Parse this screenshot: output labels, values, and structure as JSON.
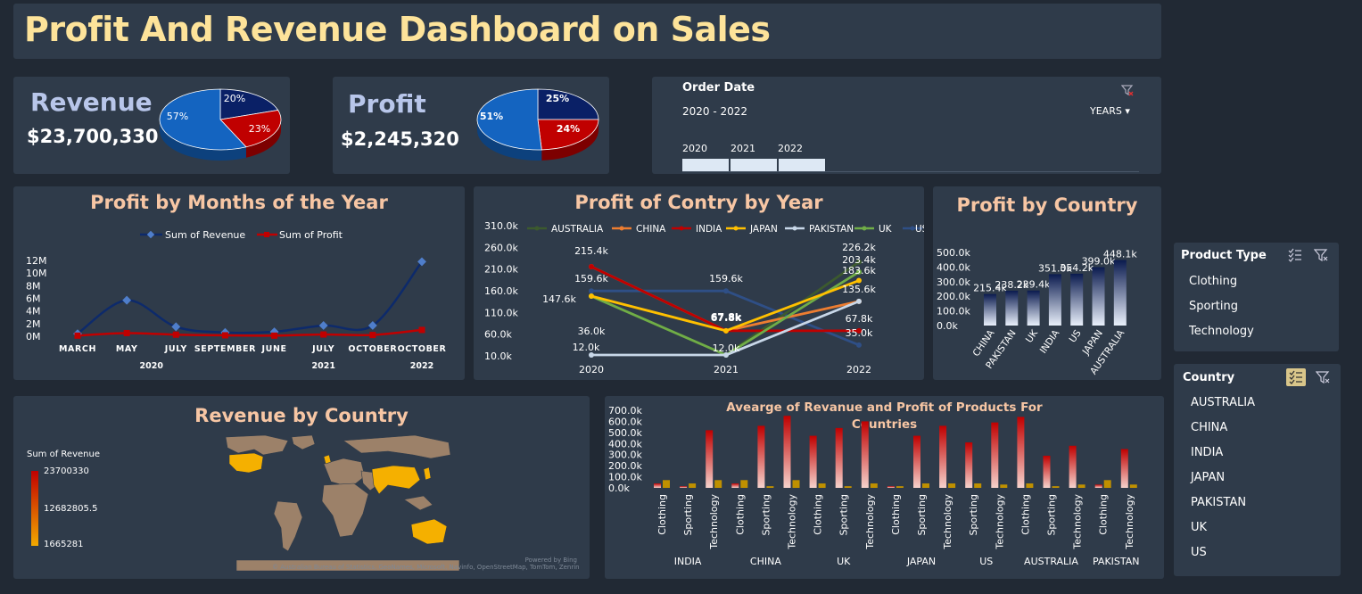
{
  "dashboard": {
    "title": "Profit And Revenue Dashboard on Sales"
  },
  "kpis": {
    "revenue": {
      "label": "Revenue",
      "value": "$23,700,330",
      "slices": [
        57,
        20,
        23
      ],
      "slice_labels": [
        "57%",
        "20%",
        "23%"
      ],
      "colors": [
        "#1464c0",
        "#0a2066",
        "#c00000"
      ]
    },
    "profit": {
      "label": "Profit",
      "value": "$2,245,320",
      "slices": [
        51,
        25,
        24
      ],
      "slice_labels": [
        "51%",
        "25%",
        "24%"
      ],
      "colors": [
        "#1464c0",
        "#0a2066",
        "#c00000"
      ]
    }
  },
  "timeline": {
    "title": "Order Date",
    "range": "2020 - 2022",
    "unit": "YEARS",
    "years": [
      "2020",
      "2021",
      "2022"
    ]
  },
  "months_chart": {
    "title": "Profit by Months of the Year",
    "legend": [
      "Sum of Revenue",
      "Sum of Profit"
    ],
    "colors": [
      "#0d2a6b",
      "#c00000"
    ],
    "y_ticks": [
      "12M",
      "10M",
      "8M",
      "6M",
      "4M",
      "2M",
      "0M"
    ],
    "months": [
      "MARCH",
      "MAY",
      "JULY",
      "SEPTEMBER",
      "JUNE",
      "JULY",
      "OCTOBER",
      "OCTOBER"
    ],
    "years": [
      "2020",
      "2021",
      "2022"
    ]
  },
  "country_year_chart": {
    "title": "Profit of Contry by Year",
    "legend": [
      "AUSTRALIA",
      "CHINA",
      "INDIA",
      "JAPAN",
      "PAKISTAN",
      "UK",
      "US"
    ],
    "colors": [
      "#3c5a2e",
      "#ed7d31",
      "#c00000",
      "#ffc000",
      "#c8d7e8",
      "#70ad47",
      "#2f4f86"
    ],
    "y_ticks": [
      "310.0k",
      "260.0k",
      "210.0k",
      "160.0k",
      "110.0k",
      "60.0k",
      "10.0k"
    ],
    "x_labels": [
      "2020",
      "2021",
      "2022"
    ],
    "data_labels": [
      "215.4k",
      "159.6k",
      "147.6k",
      "36.0k",
      "12.0k",
      "159.6k",
      "67.8k",
      "67.8k",
      "12.0k",
      "226.2k",
      "203.4k",
      "183.6k",
      "135.6k",
      "67.8k",
      "35.0k"
    ]
  },
  "profit_country_chart": {
    "title": "Profit by Country",
    "y_ticks": [
      "500.0k",
      "400.0k",
      "300.0k",
      "200.0k",
      "100.0k",
      "0.0k"
    ],
    "bar_top": "#0a1a4e",
    "bar_bottom": "#e9f0fb"
  },
  "revenue_map": {
    "title": "Revenue by Country",
    "legend_title": "Sum of Revenue",
    "legend_values": [
      "23700330",
      "12682805.5",
      "1665281"
    ],
    "attribution_1": "Powered by Bing",
    "attribution_2": "© Australian Bureau of Statistics, GeoNames, Microsoft, Navinfo, OpenStreetMap, TomTom, Zenrin"
  },
  "products_chart": {
    "title_1": "Avearge of Revanue and Profit of Products For",
    "title_2": "Countries",
    "y_ticks": [
      "700.0k",
      "600.0k",
      "500.0k",
      "400.0k",
      "300.0k",
      "200.0k",
      "100.0k",
      "0.0k"
    ],
    "countries": [
      "INDIA",
      "CHINA",
      "UK",
      "JAPAN",
      "US",
      "AUSTRALIA",
      "PAKISTAN"
    ],
    "products": [
      "Clothing",
      "Sporting",
      "Technology"
    ],
    "colors": [
      "#c00000",
      "#bf9000"
    ]
  },
  "product_slicer": {
    "title": "Product Type",
    "items": [
      "Clothing",
      "Sporting",
      "Technology"
    ]
  },
  "country_slicer": {
    "title": "Country",
    "items": [
      "AUSTRALIA",
      "CHINA",
      "INDIA",
      "JAPAN",
      "PAKISTAN",
      "UK",
      "US"
    ]
  },
  "chart_data": [
    {
      "type": "pie",
      "title": "Revenue",
      "categories": [
        "",
        "",
        ""
      ],
      "values": [
        57,
        20,
        23
      ]
    },
    {
      "type": "pie",
      "title": "Profit",
      "categories": [
        "",
        "",
        ""
      ],
      "values": [
        51,
        25,
        24
      ]
    },
    {
      "type": "line",
      "title": "Profit by Months of the Year",
      "categories": [
        "2020 MARCH",
        "2020 MAY",
        "2020 JULY",
        "2020 SEPTEMBER",
        "2021 JUNE",
        "2021 JULY",
        "2021 OCTOBER",
        "2022 OCTOBER"
      ],
      "series": [
        {
          "name": "Sum of Revenue",
          "values": [
            400000,
            5700000,
            1500000,
            600000,
            700000,
            1700000,
            1700000,
            11800000
          ]
        },
        {
          "name": "Sum of Profit",
          "values": [
            100000,
            500000,
            250000,
            150000,
            100000,
            280000,
            200000,
            1000000
          ]
        }
      ],
      "ylim": [
        0,
        12000000
      ]
    },
    {
      "type": "line",
      "title": "Profit of Contry by Year",
      "categories": [
        "2020",
        "2021",
        "2022"
      ],
      "series": [
        {
          "name": "AUSTRALIA",
          "values": [
            147600,
            12000,
            226200
          ]
        },
        {
          "name": "CHINA",
          "values": [
            215400,
            67800,
            135600
          ]
        },
        {
          "name": "INDIA",
          "values": [
            215400,
            67800,
            67800
          ]
        },
        {
          "name": "JAPAN",
          "values": [
            147600,
            67800,
            183600
          ]
        },
        {
          "name": "PAKISTAN",
          "values": [
            12000,
            12000,
            135600
          ]
        },
        {
          "name": "UK",
          "values": [
            147600,
            12000,
            203400
          ]
        },
        {
          "name": "US",
          "values": [
            159600,
            159600,
            35000
          ]
        }
      ],
      "ylim": [
        10000,
        310000
      ]
    },
    {
      "type": "bar",
      "title": "Profit by Country",
      "categories": [
        "CHINA",
        "PAKISTAN",
        "UK",
        "INDIA",
        "US",
        "JAPAN",
        "AUSTRALIA"
      ],
      "values": [
        215400,
        238200,
        239400,
        351000,
        354200,
        399000,
        448100
      ],
      "data_labels": [
        "215.4k",
        "238.2k",
        "239.4k",
        "351.0k",
        "354.2k",
        "399.0k",
        "448.1k"
      ],
      "ylim": [
        0,
        500000
      ]
    },
    {
      "type": "bar",
      "title": "Avearge of Revanue and Profit of Products For Countries",
      "categories": [
        "INDIA Clothing",
        "INDIA Sporting",
        "INDIA Technology",
        "CHINA Clothing",
        "CHINA Sporting",
        "CHINA Technology",
        "UK Clothing",
        "UK Sporting",
        "UK Technology",
        "JAPAN Clothing",
        "JAPAN Sporting",
        "JAPAN Technology",
        "US Sporting",
        "US Technology",
        "AUSTRALIA Clothing",
        "AUSTRALIA Sporting",
        "AUSTRALIA Technology",
        "PAKISTAN Clothing",
        "PAKISTAN Technology"
      ],
      "series": [
        {
          "name": "",
          "values": [
            40000,
            15000,
            520000,
            40000,
            560000,
            650000,
            470000,
            540000,
            600000,
            15000,
            470000,
            560000,
            410000,
            590000,
            640000,
            290000,
            380000,
            30000,
            350000
          ]
        },
        {
          "name": "",
          "values": [
            70000,
            40000,
            70000,
            70000,
            15000,
            70000,
            40000,
            15000,
            40000,
            15000,
            40000,
            40000,
            40000,
            30000,
            40000,
            15000,
            30000,
            70000,
            30000
          ]
        }
      ],
      "ylim": [
        0,
        700000
      ]
    }
  ]
}
